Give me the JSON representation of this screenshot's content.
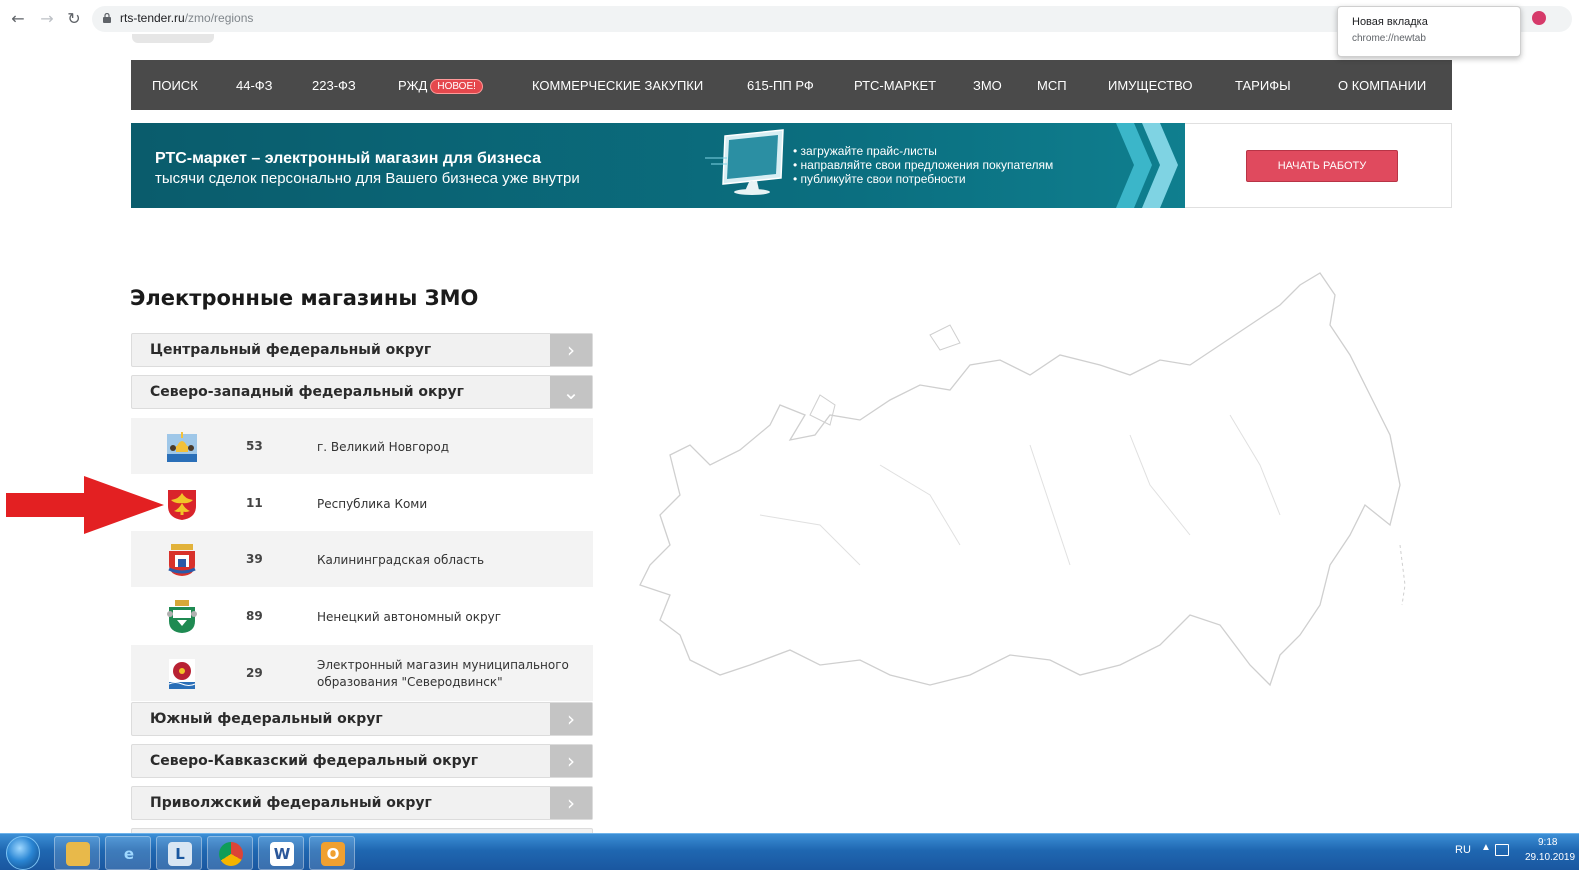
{
  "browser": {
    "url_domain": "rts-tender.ru",
    "url_path": "/zmo/regions",
    "tooltip_title": "Новая вкладка",
    "tooltip_sub": "chrome://newtab"
  },
  "nav": {
    "items": [
      "ПОИСК",
      "44-ФЗ",
      "223-ФЗ",
      "РЖД",
      "КОММЕРЧЕСКИЕ ЗАКУПКИ",
      "615-ПП РФ",
      "РТС-МАРКЕТ",
      "ЗМО",
      "МСП",
      "ИМУЩЕСТВО",
      "ТАРИФЫ",
      "О КОМПАНИИ"
    ],
    "badge": "НОВОЕ!"
  },
  "banner": {
    "title": "РТС-маркет – электронный магазин для бизнеса",
    "subtitle": "тысячи сделок персонально для Вашего бизнеса уже внутри",
    "bullets": [
      "загружайте прайс-листы",
      "направляйте свои предложения покупателям",
      "публикуйте свои потребности"
    ],
    "button": "НАЧАТЬ РАБОТУ"
  },
  "page_title": "Электронные магазины ЗМО",
  "districts": [
    {
      "label": "Центральный федеральный округ",
      "expanded": false
    },
    {
      "label": "Северо-западный федеральный округ",
      "expanded": true
    },
    {
      "label": "Южный федеральный округ",
      "expanded": false
    },
    {
      "label": "Северо-Кавказский федеральный округ",
      "expanded": false
    },
    {
      "label": "Приволжский федеральный округ",
      "expanded": false
    }
  ],
  "regions": [
    {
      "code": "53",
      "name": "г. Великий Новгород",
      "emblem": "novgorod-emblem"
    },
    {
      "code": "11",
      "name": "Республика Коми",
      "emblem": "komi-emblem"
    },
    {
      "code": "39",
      "name": "Калининградская область",
      "emblem": "kaliningrad-emblem"
    },
    {
      "code": "89",
      "name": "Ненецкий автономный округ",
      "emblem": "nenets-emblem"
    },
    {
      "code": "29",
      "name": "Электронный магазин муниципального образования \"Северодвинск\"",
      "emblem": "severodvinsk-emblem"
    }
  ],
  "taskbar": {
    "lang": "RU",
    "time": "9:18",
    "date": "29.10.2019",
    "apps": [
      "explorer-icon",
      "ie-icon",
      "terminal-icon",
      "chrome-icon",
      "word-icon",
      "outlook-icon"
    ]
  },
  "colors": {
    "nav_bg": "#4a4a4a",
    "badge": "#e5484d",
    "banner_bg": "#0b6f80",
    "button": "#e04a5e",
    "arrow": "#e32022"
  }
}
